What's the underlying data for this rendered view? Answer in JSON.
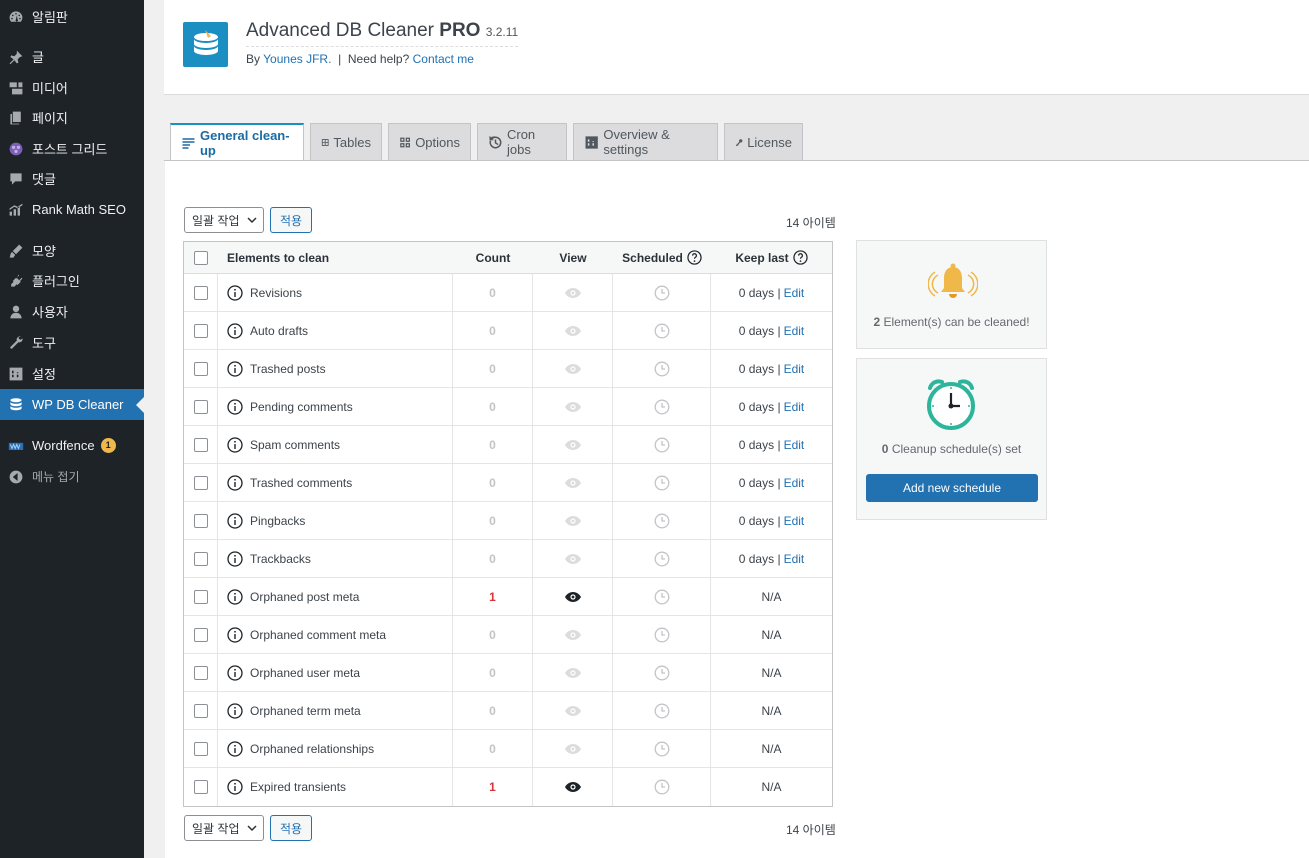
{
  "sidebar": {
    "items": [
      {
        "label": "알림판",
        "icon": "dashboard-icon"
      },
      {
        "label": "글",
        "icon": "pin-icon"
      },
      {
        "label": "미디어",
        "icon": "media-icon"
      },
      {
        "label": "페이지",
        "icon": "page-icon"
      },
      {
        "label": "포스트 그리드",
        "icon": "grid-icon"
      },
      {
        "label": "댓글",
        "icon": "comment-icon"
      },
      {
        "label": "Rank Math SEO",
        "icon": "chart-icon"
      },
      {
        "label": "모양",
        "icon": "brush-icon"
      },
      {
        "label": "플러그인",
        "icon": "plugin-icon"
      },
      {
        "label": "사용자",
        "icon": "user-icon"
      },
      {
        "label": "도구",
        "icon": "wrench-icon"
      },
      {
        "label": "설정",
        "icon": "settings-icon"
      },
      {
        "label": "WP DB Cleaner",
        "icon": "database-icon"
      },
      {
        "label": "Wordfence",
        "icon": "wordfence-icon",
        "badge": "1"
      },
      {
        "label": "메뉴 접기",
        "icon": "collapse-icon"
      }
    ]
  },
  "header": {
    "title": "Advanced DB Cleaner",
    "title_bold": "PRO",
    "version": "3.2.11",
    "by_label": "By",
    "author": "Younes JFR.",
    "separator": "|",
    "help_label": "Need help?",
    "contact": "Contact me"
  },
  "tabs": [
    {
      "label": "General clean-up",
      "icon": "list-icon"
    },
    {
      "label": "Tables",
      "icon": "table-icon"
    },
    {
      "label": "Options",
      "icon": "options-icon"
    },
    {
      "label": "Cron jobs",
      "icon": "history-icon"
    },
    {
      "label": "Overview & settings",
      "icon": "settings-icon"
    },
    {
      "label": "License",
      "icon": "key-icon"
    }
  ],
  "bulk": {
    "select_label": "일괄 작업",
    "apply_label": "적용",
    "items_count": "14 아이템"
  },
  "table": {
    "headers": {
      "name": "Elements to clean",
      "count": "Count",
      "view": "View",
      "scheduled": "Scheduled",
      "keep": "Keep last"
    },
    "rows": [
      {
        "name": "Revisions",
        "count": "0",
        "viewable": false,
        "keep": "0 days |",
        "edit": "Edit"
      },
      {
        "name": "Auto drafts",
        "count": "0",
        "viewable": false,
        "keep": "0 days |",
        "edit": "Edit"
      },
      {
        "name": "Trashed posts",
        "count": "0",
        "viewable": false,
        "keep": "0 days |",
        "edit": "Edit"
      },
      {
        "name": "Pending comments",
        "count": "0",
        "viewable": false,
        "keep": "0 days |",
        "edit": "Edit"
      },
      {
        "name": "Spam comments",
        "count": "0",
        "viewable": false,
        "keep": "0 days |",
        "edit": "Edit"
      },
      {
        "name": "Trashed comments",
        "count": "0",
        "viewable": false,
        "keep": "0 days |",
        "edit": "Edit"
      },
      {
        "name": "Pingbacks",
        "count": "0",
        "viewable": false,
        "keep": "0 days |",
        "edit": "Edit"
      },
      {
        "name": "Trackbacks",
        "count": "0",
        "viewable": false,
        "keep": "0 days |",
        "edit": "Edit"
      },
      {
        "name": "Orphaned post meta",
        "count": "1",
        "viewable": true,
        "keep": "N/A",
        "edit": ""
      },
      {
        "name": "Orphaned comment meta",
        "count": "0",
        "viewable": false,
        "keep": "N/A",
        "edit": ""
      },
      {
        "name": "Orphaned user meta",
        "count": "0",
        "viewable": false,
        "keep": "N/A",
        "edit": ""
      },
      {
        "name": "Orphaned term meta",
        "count": "0",
        "viewable": false,
        "keep": "N/A",
        "edit": ""
      },
      {
        "name": "Orphaned relationships",
        "count": "0",
        "viewable": false,
        "keep": "N/A",
        "edit": ""
      },
      {
        "name": "Expired transients",
        "count": "1",
        "viewable": true,
        "keep": "N/A",
        "edit": ""
      }
    ]
  },
  "boxes": {
    "cleanable_count": "2",
    "cleanable_text": "Element(s) can be cleaned!",
    "schedule_count": "0",
    "schedule_text": "Cleanup schedule(s) set",
    "add_schedule": "Add new schedule"
  },
  "colors": {
    "accent": "#2271b1",
    "sidebar_bg": "#1d2327",
    "bell": "#f0b849",
    "clock": "#2cb59a",
    "count_red": "#d63638"
  }
}
